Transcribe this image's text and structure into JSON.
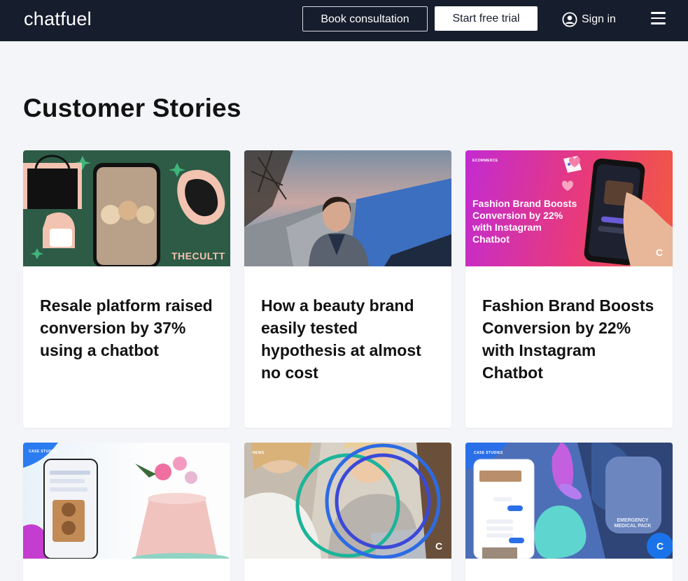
{
  "header": {
    "logo": "chatfuel",
    "book_label": "Book consultation",
    "trial_label": "Start free trial",
    "signin_label": "Sign in"
  },
  "page_title": "Customer Stories",
  "cards": [
    {
      "title": "Resale platform raised conversion by 37% using a chatbot",
      "image_brand": "THECULTT"
    },
    {
      "title": "How a beauty brand easily tested hypothesis at almost no cost"
    },
    {
      "title": "Fashion Brand Boosts Conversion by 22% with Instagram Chatbot",
      "image_tag": "ECOMMERCE",
      "image_text": "Fashion Brand Boosts Conversion by 22% with Instagram Chatbot"
    },
    {
      "title": "",
      "image_tag": "CASE STUDIES"
    },
    {
      "title": "",
      "image_tag": "NEWS"
    },
    {
      "title": "",
      "image_tag": "CASE STUDIES",
      "image_text": "EMERGENCY MEDICAL PACK"
    }
  ],
  "colors": {
    "header_bg": "#161d2c",
    "page_bg": "#f4f5f8",
    "accent_blue": "#1a73e8"
  }
}
